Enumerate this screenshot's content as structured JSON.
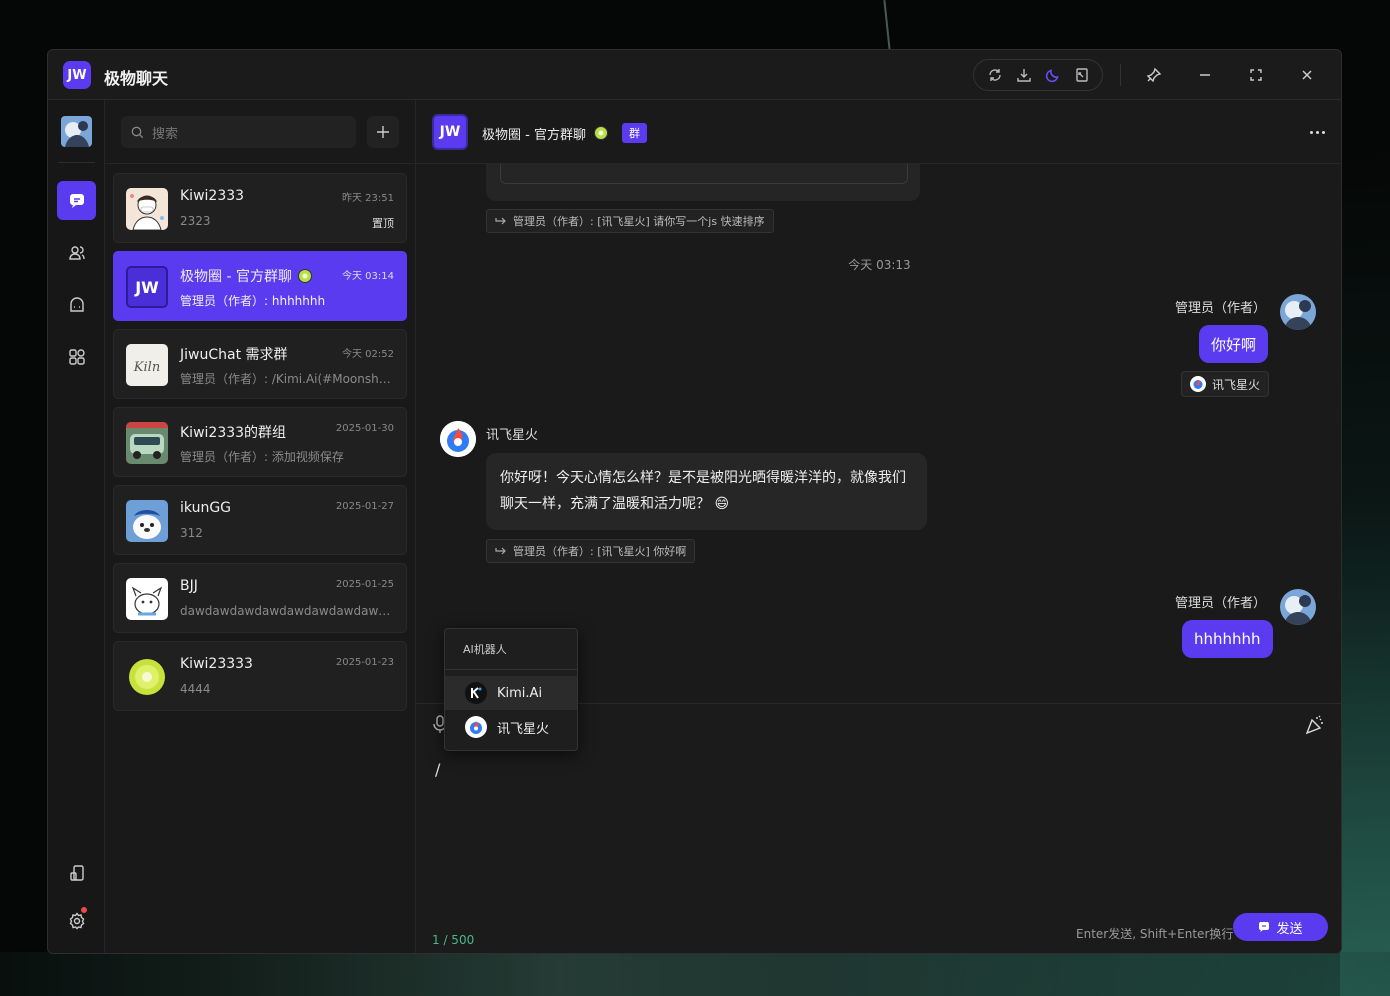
{
  "app": {
    "logo": "JW",
    "title": "极物聊天"
  },
  "toolbar": {
    "icons": [
      "refresh-icon",
      "download-icon",
      "moon-icon",
      "window-icon"
    ],
    "accent": "#5b3bf0"
  },
  "window_controls": [
    "pin-icon",
    "minimize-icon",
    "maximize-icon",
    "close-icon"
  ],
  "search": {
    "placeholder": "搜索"
  },
  "sessions": [
    {
      "name": "Kiwi2333",
      "time": "昨天 23:51",
      "preview": "2323",
      "pinned": "置顶"
    },
    {
      "name": "极物圈 - 官方群聊",
      "time": "今天 03:14",
      "preview": "管理员（作者）: hhhhhhh",
      "active": true
    },
    {
      "name": "JiwuChat 需求群",
      "time": "今天 02:52",
      "preview": "管理员（作者）: /Kimi.Ai(#Moonshot..."
    },
    {
      "name": "Kiwi2333的群组",
      "time": "2025-01-30",
      "preview": "管理员（作者）:  添加视频保存"
    },
    {
      "name": "ikunGG",
      "time": "2025-01-27",
      "preview": "312"
    },
    {
      "name": "BJJ",
      "time": "2025-01-25",
      "preview": "dawdawdawdawdawdawdawdawdawdaw..."
    },
    {
      "name": "Kiwi23333",
      "time": "2025-01-23",
      "preview": "4444"
    }
  ],
  "chat": {
    "avatar": "JW",
    "title": "极物圈 - 官方群聊",
    "group_tag": "群",
    "quote_1": "管理员（作者）: [讯飞星火] 请你写一个js 快速排序",
    "timestamp": "今天 03:13",
    "me_name": "管理员（作者）",
    "msg_1": "你好啊",
    "model_tag": "讯飞星火",
    "bot_name": "讯飞星火",
    "bot_msg": "你好呀！今天心情怎么样？是不是被阳光晒得暖洋洋的，就像我们聊天一样，充满了温暖和活力呢？",
    "bot_emoji": "😄",
    "quote_2": "管理员（作者）: [讯飞星火] 你好啊",
    "me_name_2": "管理员（作者）",
    "msg_2": "hhhhhhh"
  },
  "composer": {
    "text": "/",
    "counter": "1 / 500",
    "hint": "Enter发送, Shift+Enter换行",
    "send_label": "发送"
  },
  "ai_popup": {
    "title": "AI机器人",
    "items": [
      "Kimi.Ai",
      "讯飞星火"
    ]
  }
}
